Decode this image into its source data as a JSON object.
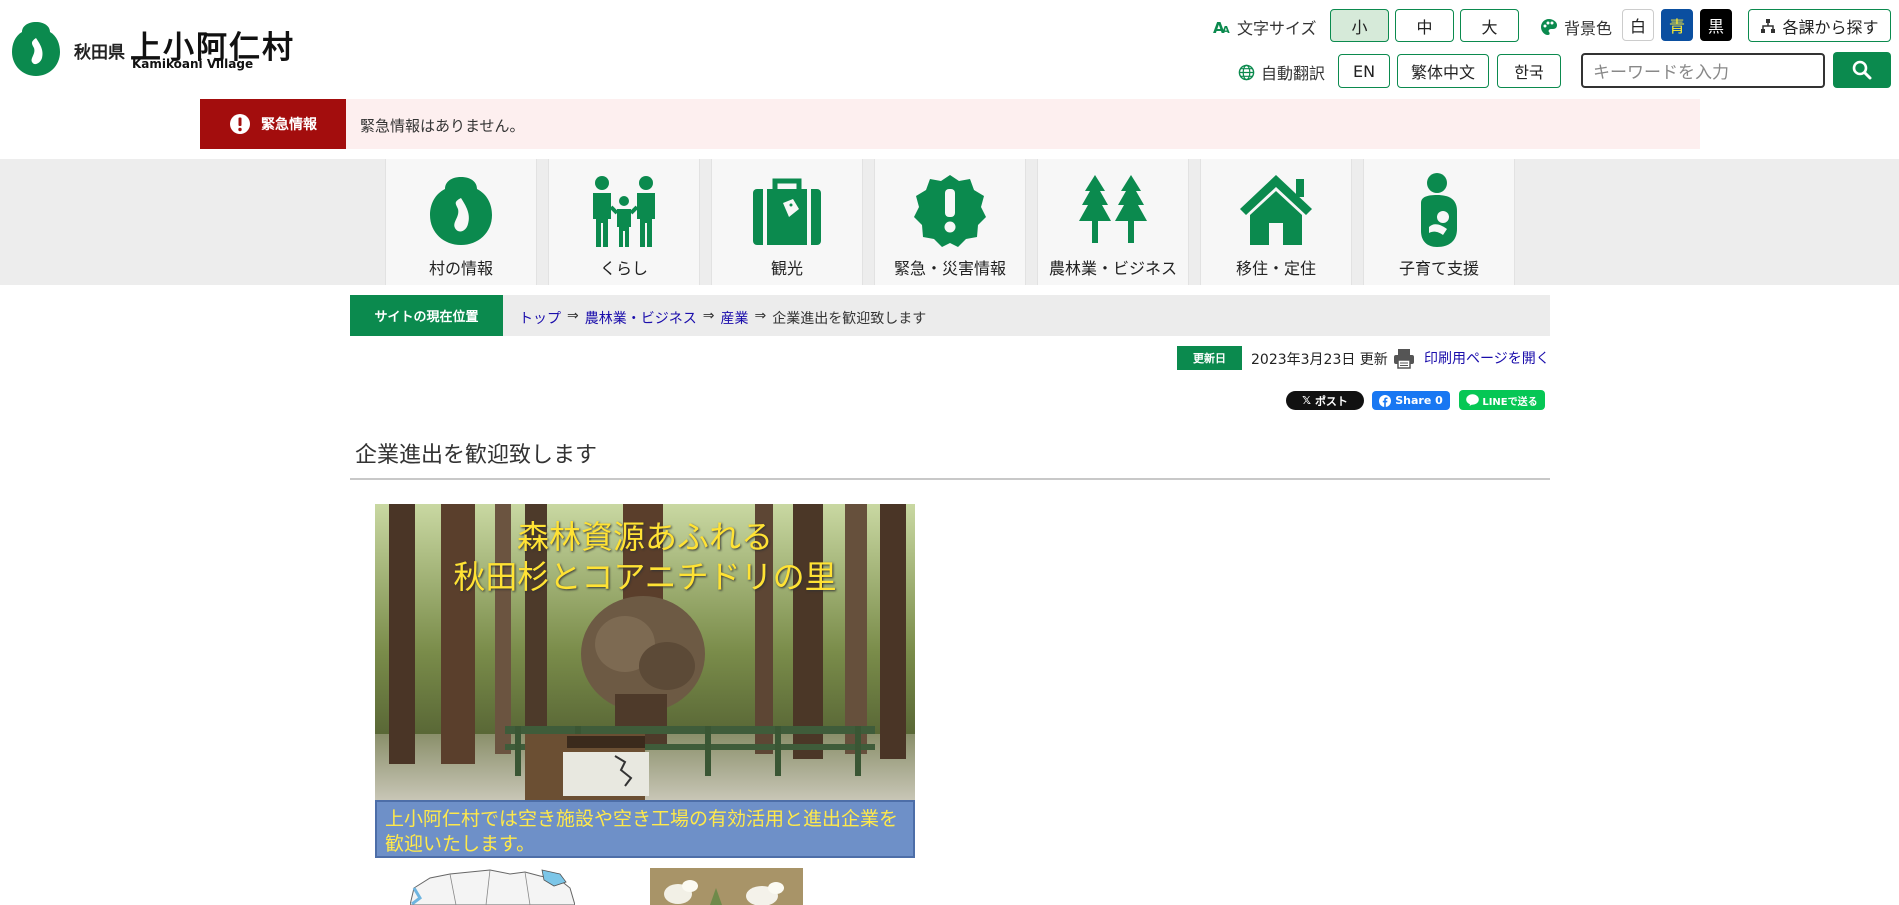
{
  "header": {
    "pref": "秋田県",
    "village_name": "上小阿仁村",
    "village_en": "Kamikoani Village"
  },
  "tools": {
    "font_size_label": "文字サイズ",
    "font_sizes": [
      "小",
      "中",
      "大"
    ],
    "bg_color_label": "背景色",
    "bg_colors": [
      {
        "label": "白",
        "bg": "#ffffff",
        "fg": "#222222"
      },
      {
        "label": "青",
        "bg": "#0b4fa0",
        "fg": "#ffee33"
      },
      {
        "label": "黒",
        "bg": "#000000",
        "fg": "#ffffff"
      }
    ],
    "dept_search_label": "各課から探す",
    "translate_label": "自動翻訳",
    "languages": [
      "EN",
      "繁体中文",
      "한국"
    ],
    "search_placeholder": "キーワードを入力"
  },
  "emergency": {
    "label": "緊急情報",
    "text": "緊急情報はありません。"
  },
  "nav": [
    {
      "label": "村の情報",
      "icon": "village-logo-icon"
    },
    {
      "label": "くらし",
      "icon": "family-icon"
    },
    {
      "label": "観光",
      "icon": "suitcase-icon"
    },
    {
      "label": "緊急・災害情報",
      "icon": "alert-icon"
    },
    {
      "label": "農林業・ビジネス",
      "icon": "trees-icon"
    },
    {
      "label": "移住・定住",
      "icon": "house-icon"
    },
    {
      "label": "子育て支援",
      "icon": "parent-child-icon"
    }
  ],
  "breadcrumb": {
    "label": "サイトの現在位置",
    "items": [
      "トップ",
      "農林業・ビジネス",
      "産業"
    ],
    "current": "企業進出を歓迎致します",
    "arrow": "⇒"
  },
  "update": {
    "badge": "更新日",
    "date": "2023年3月23日 更新",
    "print_link": "印刷用ページを開く"
  },
  "social": {
    "x_label": "ポスト",
    "fb_label": "Share 0",
    "line_label": "LINEで送る"
  },
  "page": {
    "title": "企業進出を歓迎致します"
  },
  "hero": {
    "line1": "森林資源あふれる",
    "line2": "秋田杉とコアニチドリの里",
    "caption": "上小阿仁村では空き施設や空き工場の有効活用と進出企業を歓迎いたします。"
  },
  "colors": {
    "brand_green": "#0b8a4e",
    "emergency_red": "#a30d0d",
    "emergency_bg": "#fdefef",
    "link": "#1a0dab"
  }
}
